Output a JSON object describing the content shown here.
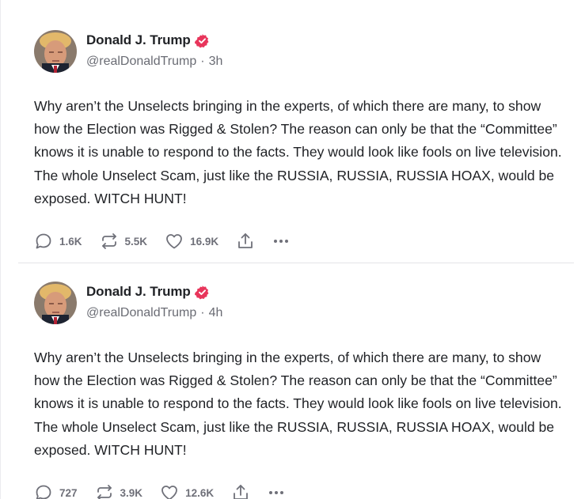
{
  "posts": [
    {
      "author": "Donald J. Trump",
      "handle": "@realDonaldTrump",
      "separator": "·",
      "time": "3h",
      "text": "Why aren’t the Unselects bringing in the experts, of which there are many, to show how the Election was Rigged & Stolen? The reason can only be that the “Committee” knows it is unable to respond to the facts. They would look like fools on live television. The whole Unselect Scam, just like the RUSSIA, RUSSIA, RUSSIA HOAX, would be exposed. WITCH HUNT!",
      "replies": "1.6K",
      "reposts": "5.5K",
      "likes": "16.9K"
    },
    {
      "author": "Donald J. Trump",
      "handle": "@realDonaldTrump",
      "separator": "·",
      "time": "4h",
      "text": "Why aren’t the Unselects bringing in the experts, of which there are many, to show how the Election was Rigged & Stolen? The reason can only be that the “Committee” knows it is unable to respond to the facts. They would look like fools on live television. The whole Unselect Scam, just like the RUSSIA, RUSSIA, RUSSIA HOAX, would be exposed. WITCH HUNT!",
      "replies": "727",
      "reposts": "3.9K",
      "likes": "12.6K"
    }
  ],
  "icons": {
    "verified": "verified-badge-icon",
    "reply": "reply-icon",
    "repost": "repost-icon",
    "like": "heart-icon",
    "share": "share-icon",
    "more": "more-icon"
  },
  "colors": {
    "verified": "#e8355b",
    "text": "#1f2125",
    "muted": "#6a6c74"
  }
}
